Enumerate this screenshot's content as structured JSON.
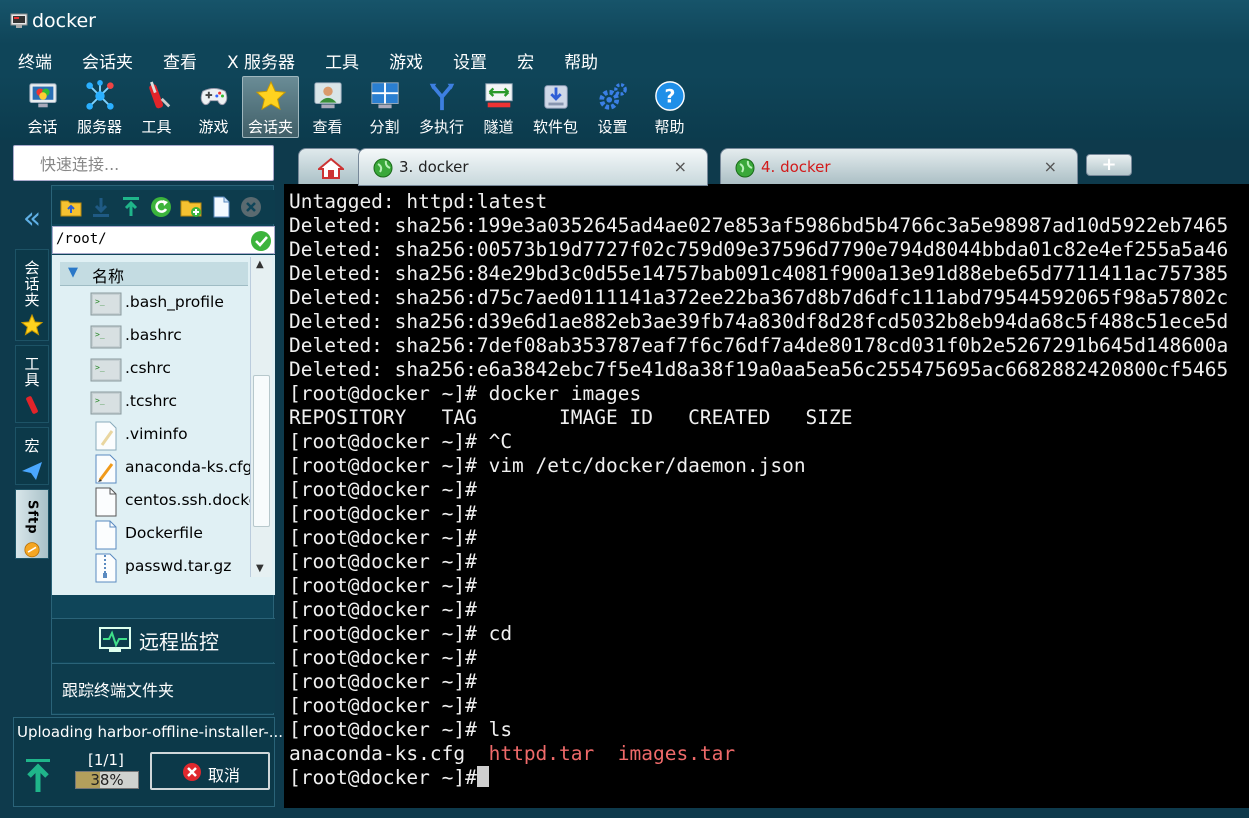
{
  "window": {
    "title": "docker"
  },
  "menu": [
    "终端",
    "会话夹",
    "查看",
    "X 服务器",
    "工具",
    "游戏",
    "设置",
    "宏",
    "帮助"
  ],
  "toolbar": [
    {
      "label": "会话",
      "icon": "session-icon"
    },
    {
      "label": "服务器",
      "icon": "servers-icon"
    },
    {
      "label": "工具",
      "icon": "tools-icon"
    },
    {
      "label": "游戏",
      "icon": "gamepad-icon"
    },
    {
      "label": "会话夹",
      "icon": "star-icon"
    },
    {
      "label": "查看",
      "icon": "view-icon"
    },
    {
      "label": "分割",
      "icon": "split-icon"
    },
    {
      "label": "多执行",
      "icon": "multiexec-icon"
    },
    {
      "label": "隧道",
      "icon": "tunnel-icon"
    },
    {
      "label": "软件包",
      "icon": "package-icon"
    },
    {
      "label": "设置",
      "icon": "settings-icon"
    },
    {
      "label": "帮助",
      "icon": "help-icon"
    }
  ],
  "quick_connect": {
    "placeholder": "快速连接..."
  },
  "tabs": [
    {
      "label": "3. docker",
      "close": "×"
    },
    {
      "label": "4. docker",
      "close": "×"
    }
  ],
  "new_tab": "+",
  "side_tabs": [
    {
      "label": "会话夹",
      "icon": "star-icon"
    },
    {
      "label": "工具",
      "icon": "tools-icon"
    },
    {
      "label": "宏",
      "icon": "paper-plane-icon"
    },
    {
      "label": "Sftp",
      "icon": "sftp-icon"
    }
  ],
  "sftp": {
    "path": "/root/",
    "column_header": "名称",
    "files": [
      {
        "name": ".bash_profile",
        "type": "terminal-file"
      },
      {
        "name": ".bashrc",
        "type": "terminal-file"
      },
      {
        "name": ".cshrc",
        "type": "terminal-file"
      },
      {
        "name": ".tcshrc",
        "type": "terminal-file"
      },
      {
        "name": ".viminfo",
        "type": "text-file"
      },
      {
        "name": "anaconda-ks.cfg",
        "type": "edit-file"
      },
      {
        "name": "centos.ssh.docker",
        "type": "blank-file"
      },
      {
        "name": "Dockerfile",
        "type": "blank-file"
      },
      {
        "name": "passwd.tar.gz",
        "type": "archive-file"
      }
    ],
    "remote_monitor": "远程监控",
    "follow_folder": "跟踪终端文件夹"
  },
  "upload": {
    "title": "Uploading harbor-offline-installer-...",
    "count": "[1/1]",
    "percent_text": "38%",
    "progress": 38,
    "cancel_label": "取消"
  },
  "terminal": {
    "lines": [
      {
        "text": "Untagged: httpd:latest"
      },
      {
        "text": "Deleted: sha256:199e3a0352645ad4ae027e853af5986bd5b4766c3a5e98987ad10d5922eb7465"
      },
      {
        "text": "Deleted: sha256:00573b19d7727f02c759d09e37596d7790e794d8044bbda01c82e4ef255a5a46"
      },
      {
        "text": "Deleted: sha256:84e29bd3c0d55e14757bab091c4081f900a13e91d88ebe65d7711411ac757385"
      },
      {
        "text": "Deleted: sha256:d75c7aed0111141a372ee22ba367d8b7d6dfc111abd79544592065f98a57802c"
      },
      {
        "text": "Deleted: sha256:d39e6d1ae882eb3ae39fb74a830df8d28fcd5032b8eb94da68c5f488c51ece5d"
      },
      {
        "text": "Deleted: sha256:7def08ab353787eaf7f6c76df7a4de80178cd031f0b2e5267291b645d148600a"
      },
      {
        "text": "Deleted: sha256:e6a3842ebc7f5e41d8a38f19a0aa5ea56c255475695ac6682882420800cf5465"
      },
      {
        "text": "[root@docker ~]# docker images"
      },
      {
        "text": "REPOSITORY   TAG       IMAGE ID   CREATED   SIZE"
      },
      {
        "text": "[root@docker ~]# ^C"
      },
      {
        "text": "[root@docker ~]# vim /etc/docker/daemon.json"
      },
      {
        "text": "[root@docker ~]#"
      },
      {
        "text": "[root@docker ~]#"
      },
      {
        "text": "[root@docker ~]#"
      },
      {
        "text": "[root@docker ~]#"
      },
      {
        "text": "[root@docker ~]#"
      },
      {
        "text": "[root@docker ~]#"
      },
      {
        "text": "[root@docker ~]# cd"
      },
      {
        "text": "[root@docker ~]#"
      },
      {
        "text": "[root@docker ~]#"
      },
      {
        "text": "[root@docker ~]#"
      },
      {
        "text": "[root@docker ~]# ls"
      }
    ],
    "ls_output": [
      "anaconda-ks.cfg",
      "httpd.tar",
      "images.tar"
    ],
    "prompt": "[root@docker ~]#",
    "colors": {
      "archive": "#ef6a6a",
      "text": "#f0f0f0",
      "background": "#000000"
    }
  }
}
